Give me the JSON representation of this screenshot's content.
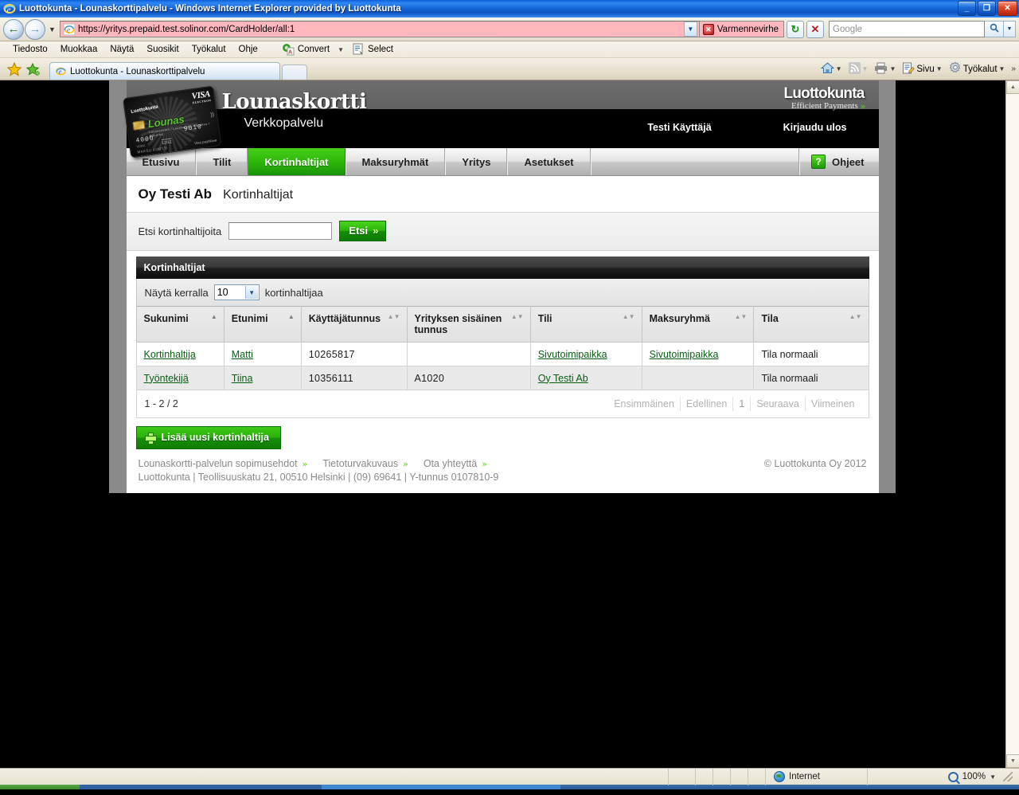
{
  "window": {
    "title": "Luottokunta - Lounaskorttipalvelu - Windows Internet Explorer provided by Luottokunta",
    "minimize_label": "_",
    "maximize_label": "❐",
    "close_label": "✕"
  },
  "addressbar": {
    "url": "https://yritys.prepaid.test.solinor.com/CardHolder/all:1",
    "cert_error": "Varmennevirhe",
    "refresh_label": "↻",
    "stop_label": "✕",
    "search_placeholder": "Google",
    "search_value": "",
    "go_label": "🔍"
  },
  "menubar": {
    "items": [
      "Tiedosto",
      "Muokkaa",
      "Näytä",
      "Suosikit",
      "Työkalut",
      "Ohje"
    ],
    "convert_label": "Convert",
    "select_label": "Select"
  },
  "tabs": {
    "active_tab_title": "Luottokunta - Lounaskorttipalvelu",
    "commands": [
      "Sivu",
      "Työkalut"
    ],
    "overflow_label": "»"
  },
  "statusbar": {
    "zone": "Internet",
    "zoom": "100%"
  },
  "site": {
    "brand_main": "Lounaskortti",
    "brand_sub": "Verkkopalvelu",
    "logo_main": "Luottokunta",
    "logo_sub": "Efficient Payments",
    "user_name": "Testi Käyttäjä",
    "logout": "Kirjaudu ulos",
    "card": {
      "visa": "VISA",
      "visa_sub": "ELECTRON",
      "issuer": "Luottokunta",
      "product": "Lounas",
      "product_sub": "Lounasseteli / Lounasraha / Sodexo / Edenred",
      "number_left": "4000",
      "number_right": "9010",
      "valid_label": "VOIM.",
      "expiry": "12/12",
      "holder": "MAKSU KORTTI",
      "paywave": "Visa payWave"
    },
    "nav": [
      {
        "label": "Etusivu",
        "active": false
      },
      {
        "label": "Tilit",
        "active": false
      },
      {
        "label": "Kortinhaltijat",
        "active": true
      },
      {
        "label": "Maksuryhmät",
        "active": false
      },
      {
        "label": "Yritys",
        "active": false
      },
      {
        "label": "Asetukset",
        "active": false
      }
    ],
    "help_label": "Ohjeet",
    "help_icon_label": "?"
  },
  "page": {
    "company": "Oy Testi Ab",
    "title": "Kortinhaltijat",
    "search_label": "Etsi kortinhaltijoita",
    "search_value": "",
    "search_button": "Etsi",
    "search_button_arrow": "»",
    "panel_title": "Kortinhaltijat",
    "per_page_prefix": "Näytä kerralla",
    "per_page_value": "10",
    "per_page_suffix": "kortinhaltijaa",
    "columns": [
      {
        "label": "Sukunimi",
        "sort": "asc"
      },
      {
        "label": "Etunimi",
        "sort": "asc"
      },
      {
        "label": "Käyttäjätunnus",
        "sort": "none"
      },
      {
        "label": "Yrityksen sisäinen tunnus",
        "sort": "none"
      },
      {
        "label": "Tili",
        "sort": "none"
      },
      {
        "label": "Maksuryhmä",
        "sort": "none"
      },
      {
        "label": "Tila",
        "sort": "none"
      }
    ],
    "rows": [
      {
        "sukunimi": "Kortinhaltija",
        "etunimi": "Matti",
        "kayttajatunnus": "10265817",
        "sisainen_tunnus": "",
        "tili": "Sivutoimipaikka",
        "maksuryhma": "Sivutoimipaikka",
        "tila": "Tila normaali"
      },
      {
        "sukunimi": "Työntekijä",
        "etunimi": "Tiina",
        "kayttajatunnus": "10356111",
        "sisainen_tunnus": "A1020",
        "tili": "Oy Testi Ab",
        "maksuryhma": "",
        "tila": "Tila normaali"
      }
    ],
    "result_count": "1 - 2 / 2",
    "pager": [
      "Ensimmäinen",
      "Edellinen",
      "1",
      "Seuraava",
      "Viimeinen"
    ],
    "add_button": "Lisää uusi kortinhaltija",
    "footer_links": [
      "Lounaskortti-palvelun sopimusehdot",
      "Tietoturvakuvaus",
      "Ota yhteyttä"
    ],
    "footer_arrow": "»",
    "footer_address": "Luottokunta | Teollisuuskatu 21, 00510 Helsinki | (09) 69641 | Y-tunnus 0107810-9",
    "copyright": "© Luottokunta Oy 2012"
  }
}
